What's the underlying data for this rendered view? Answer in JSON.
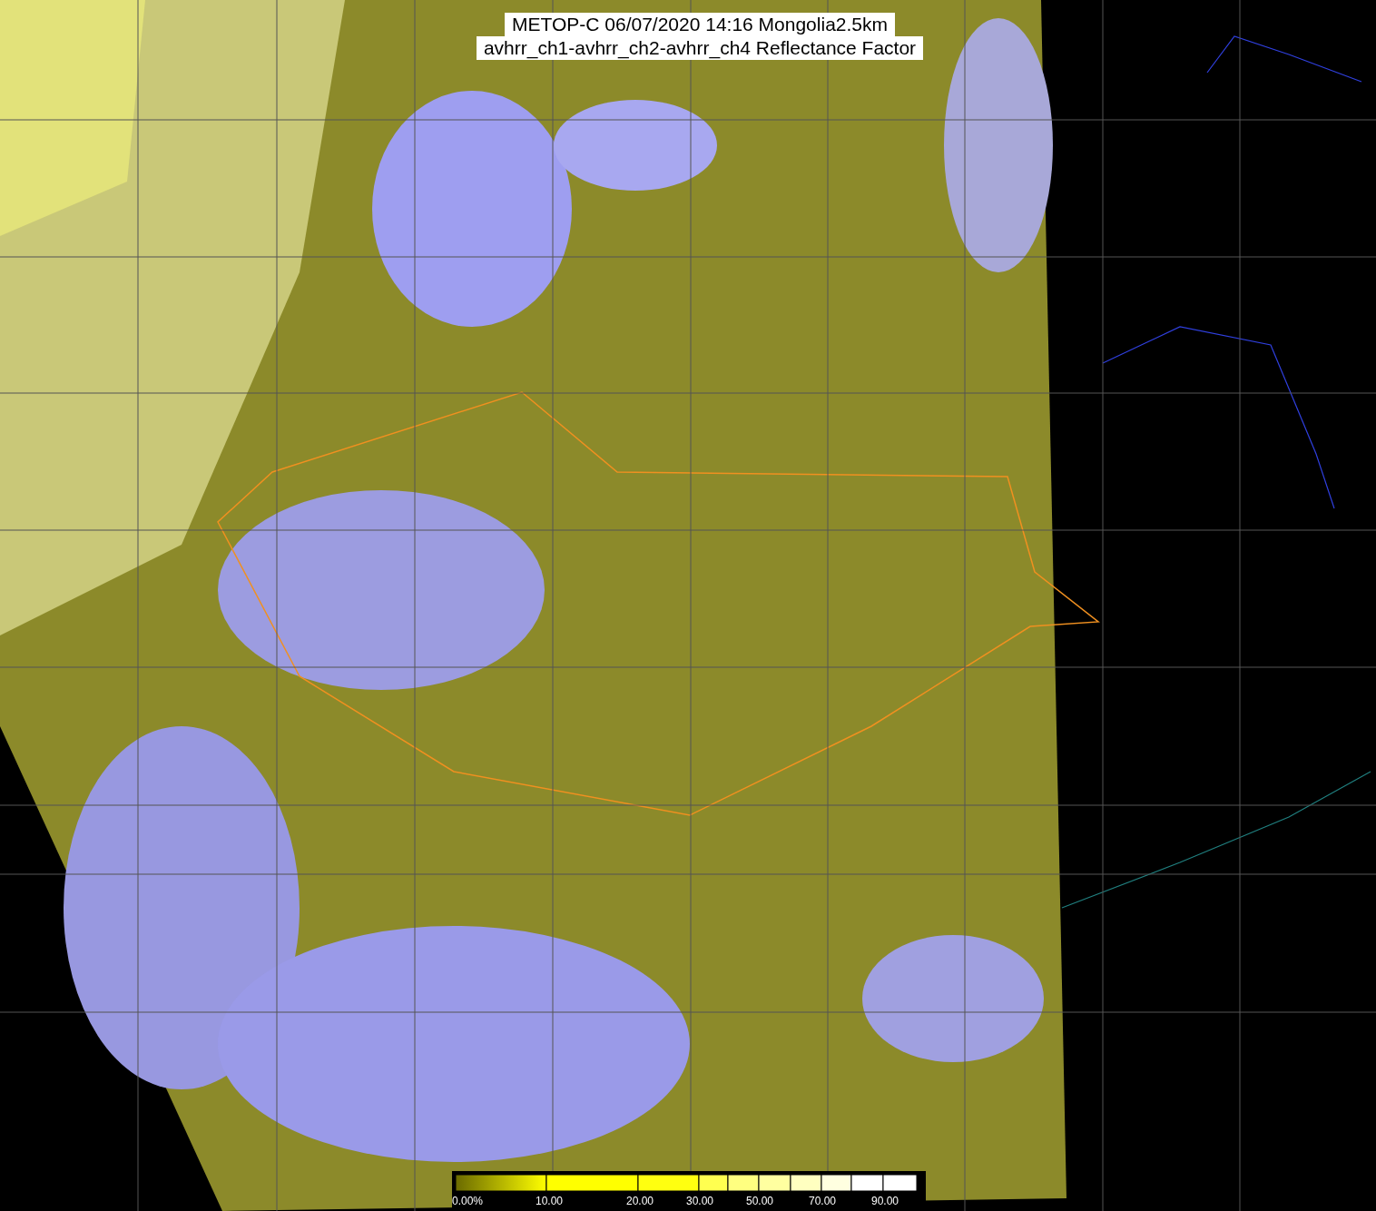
{
  "title": {
    "lines": [
      "METOP-C 06/07/2020 14:16 Mongolia2.5km",
      "avhrr_ch1-avhrr_ch2-avhrr_ch4 Reflectance Factor"
    ]
  },
  "colorbar": {
    "labels": [
      "0.00%",
      "10.00",
      "20.00",
      "30.00",
      "50.00",
      "70.00",
      "90.00"
    ]
  }
}
